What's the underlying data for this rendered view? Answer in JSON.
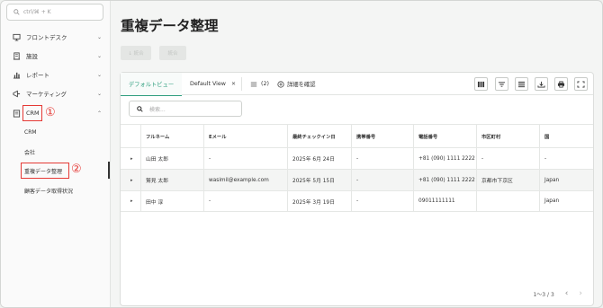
{
  "sidebar": {
    "search_placeholder": "ctrl/⌘ + K",
    "items": [
      {
        "label": "フロントデスク",
        "chevron": "⌄",
        "icon": "monitor-icon"
      },
      {
        "label": "施設",
        "chevron": "⌄",
        "icon": "building-icon"
      },
      {
        "label": "レポート",
        "chevron": "⌄",
        "icon": "bar-chart-icon"
      },
      {
        "label": "マーケティング",
        "chevron": "⌄",
        "icon": "megaphone-icon"
      },
      {
        "label": "CRM",
        "chevron": "⌃",
        "icon": "crm-icon"
      }
    ],
    "sub_items": [
      {
        "label": "CRM"
      },
      {
        "label": "会社"
      },
      {
        "label": "重複データ整理"
      },
      {
        "label": "顧客データ取得状況"
      }
    ],
    "annotations": [
      "①",
      "②"
    ]
  },
  "page": {
    "title": "重複データ整理",
    "ghost_buttons": [
      "↓ 統合",
      "統合"
    ]
  },
  "tabs": {
    "default_view": "デフォルトビュー",
    "saved_view": "Default View",
    "close_glyph": "✕",
    "filter_count": "(2)",
    "details_button": "詳細を確認"
  },
  "toolbar_icons": [
    "columns-icon",
    "filter-icon",
    "density-icon",
    "download-icon",
    "print-icon",
    "fullscreen-icon"
  ],
  "table_search_placeholder": "検索...",
  "table": {
    "columns": [
      "フルネーム",
      "Eメール",
      "最終チェックイン日",
      "携帯番号",
      "電話番号",
      "市区町村",
      "国"
    ],
    "rows": [
      [
        "山田 太郎",
        "-",
        "2025年 6月 24日",
        "-",
        "+81 (090) 1111 2222",
        "-",
        "-"
      ],
      [
        "鷲見 太郎",
        "wasimil@example.com",
        "2025年 5月 15日",
        "-",
        "+81 (090) 1111 2222",
        "京都市下京区",
        "Japan"
      ],
      [
        "田中 淳",
        "-",
        "2025年 3月 19日",
        "-",
        "09011111111",
        "",
        "Japan"
      ]
    ],
    "expander_glyph": "▸"
  },
  "pagination": {
    "range": "1〜3 / 3",
    "prev": "‹",
    "next": "›"
  },
  "colors": {
    "accent": "#2e9e7e",
    "highlight": "#e53935"
  }
}
